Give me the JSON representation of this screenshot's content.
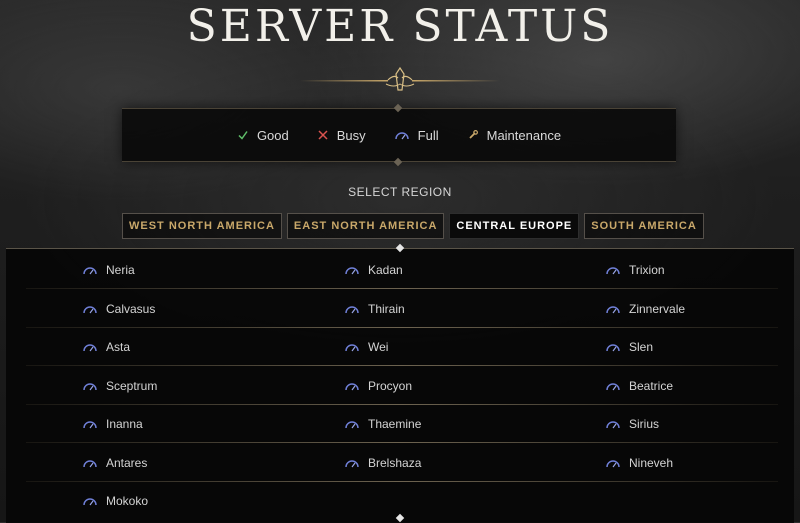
{
  "page": {
    "title": "SERVER STATUS"
  },
  "legend": {
    "items": [
      {
        "icon": "check-icon",
        "label": "Good",
        "color": "#5fbf6a"
      },
      {
        "icon": "x-icon",
        "label": "Busy",
        "color": "#d9534f"
      },
      {
        "icon": "full-gauge-icon",
        "label": "Full",
        "color": "#6f7fd6"
      },
      {
        "icon": "wrench-icon",
        "label": "Maintenance",
        "color": "#c9a86a"
      }
    ]
  },
  "region_selector": {
    "label": "SELECT REGION",
    "tabs": [
      {
        "label": "WEST NORTH AMERICA",
        "active": false
      },
      {
        "label": "EAST NORTH AMERICA",
        "active": false
      },
      {
        "label": "CENTRAL EUROPE",
        "active": true
      },
      {
        "label": "SOUTH AMERICA",
        "active": false
      }
    ]
  },
  "servers": {
    "status_icon": "full-gauge-icon",
    "rows": [
      [
        {
          "name": "Neria",
          "status": "Full"
        },
        {
          "name": "Kadan",
          "status": "Full"
        },
        {
          "name": "Trixion",
          "status": "Full"
        }
      ],
      [
        {
          "name": "Calvasus",
          "status": "Full"
        },
        {
          "name": "Thirain",
          "status": "Full"
        },
        {
          "name": "Zinnervale",
          "status": "Full"
        }
      ],
      [
        {
          "name": "Asta",
          "status": "Full"
        },
        {
          "name": "Wei",
          "status": "Full"
        },
        {
          "name": "Slen",
          "status": "Full"
        }
      ],
      [
        {
          "name": "Sceptrum",
          "status": "Full"
        },
        {
          "name": "Procyon",
          "status": "Full"
        },
        {
          "name": "Beatrice",
          "status": "Full"
        }
      ],
      [
        {
          "name": "Inanna",
          "status": "Full"
        },
        {
          "name": "Thaemine",
          "status": "Full"
        },
        {
          "name": "Sirius",
          "status": "Full"
        }
      ],
      [
        {
          "name": "Antares",
          "status": "Full"
        },
        {
          "name": "Brelshaza",
          "status": "Full"
        },
        {
          "name": "Nineveh",
          "status": "Full"
        }
      ],
      [
        {
          "name": "Mokoko",
          "status": "Full"
        }
      ]
    ]
  },
  "colors": {
    "accent_gold": "#c9a86a",
    "full_status": "#6f7fd6"
  }
}
